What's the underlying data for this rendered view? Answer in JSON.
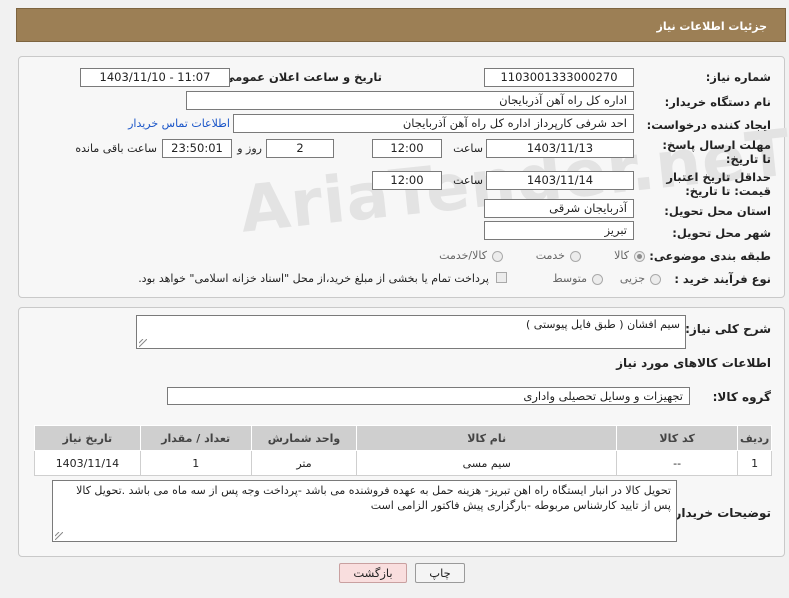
{
  "header": {
    "title": "جزئیات اطلاعات نیاز"
  },
  "watermark": "AriaTender.neT",
  "fields": {
    "need_number_label": "شماره نیاز:",
    "need_number": "1103001333000270",
    "announce_label": "تاریخ و ساعت اعلان عمومی:",
    "announce_value": "1403/11/10 - 11:07",
    "buyer_label": "نام دستگاه خریدار:",
    "buyer_value": "اداره کل راه آهن آذربایجان",
    "creator_label": "ایجاد کننده درخواست:",
    "creator_value": "احد شرفی کارپرداز اداره کل راه آهن آذربایجان",
    "contact_link": "اطلاعات تماس خریدار",
    "deadline_label": "مهلت ارسال پاسخ: تا تاریخ:",
    "deadline_date": "1403/11/13",
    "hour_label": "ساعت",
    "deadline_time": "12:00",
    "days_value": "2",
    "day_and_label": "روز و",
    "remaining_time": "23:50:01",
    "remaining_label": "ساعت باقی مانده",
    "validity_label": "حداقل تاریخ اعتبار قیمت: تا تاریخ:",
    "validity_date": "1403/11/14",
    "validity_time": "12:00",
    "province_label": "استان محل تحویل:",
    "province_value": "آذربایجان شرقی",
    "city_label": "شهر محل تحویل:",
    "city_value": "تبریز",
    "category_label": "طبقه بندی موضوعی:",
    "category_options": [
      "کالا",
      "خدمت",
      "کالا/خدمت"
    ],
    "process_label": "نوع فرآیند خرید :",
    "process_options": [
      "جزیی",
      "متوسط"
    ],
    "payment_note": "پرداخت تمام یا بخشی از مبلغ خرید،از محل \"اسناد خزانه اسلامی\" خواهد بود."
  },
  "description": {
    "label": "شرح کلی نیاز:",
    "value": "سیم افشان ( طبق فایل پیوستی )",
    "goods_info_title": "اطلاعات کالاهای مورد نیاز",
    "group_label": "گروه کالا:",
    "group_value": "تجهیزات و وسایل تحصیلی واداری"
  },
  "table": {
    "headers": [
      "ردیف",
      "کد کالا",
      "نام کالا",
      "واحد شمارش",
      "تعداد / مقدار",
      "تاریخ نیاز"
    ],
    "rows": [
      [
        "1",
        "--",
        "سیم مسی",
        "متر",
        "1",
        "1403/11/14"
      ]
    ]
  },
  "buyer_notes": {
    "label": "توضیحات خریدار:",
    "value": "تحویل کالا در انبار ایستگاه راه اهن تبریز- هزینه حمل به عهده  فروشنده می باشد -پرداخت وجه پس از سه ماه می باشد .تحویل کالا پس از  تایید کارشناس مربوطه -بارگزاری پیش فاکتور الزامی است"
  },
  "buttons": {
    "print": "چاپ",
    "back": "بازگشت"
  },
  "colors": {
    "header_bg": "#9c7f55",
    "link": "#1a55c8",
    "back_button_bg": "#f9dede"
  }
}
